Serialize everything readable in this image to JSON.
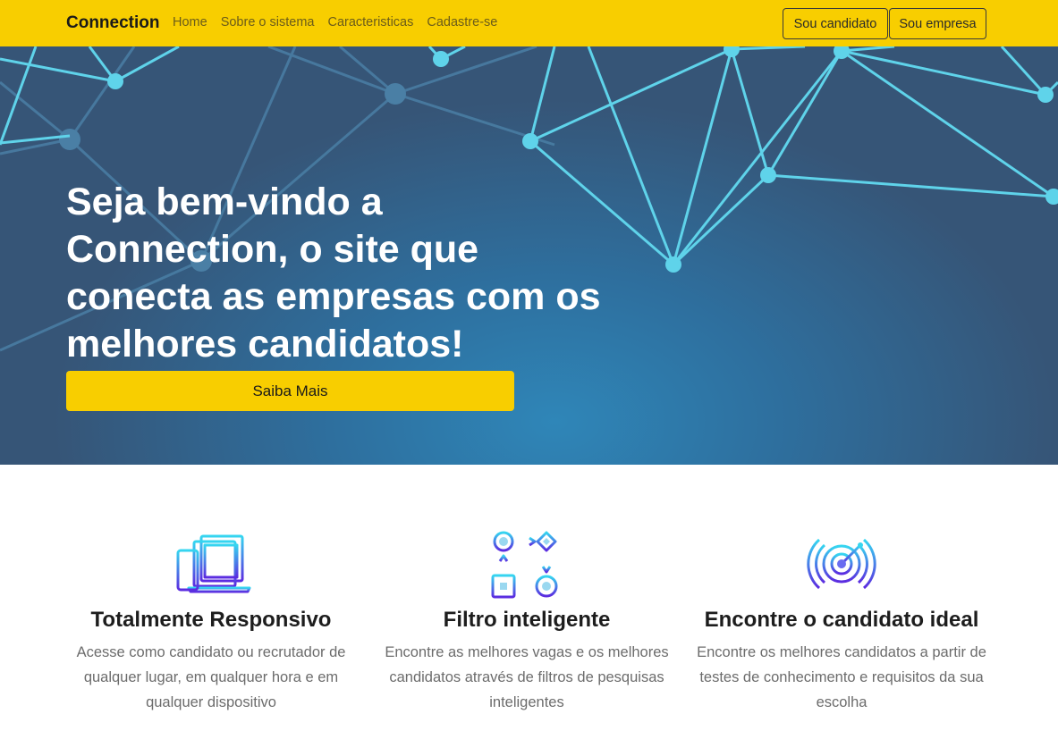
{
  "nav": {
    "brand": "Connection",
    "links": [
      "Home",
      "Sobre o sistema",
      "Caracteristicas",
      "Cadastre-se"
    ],
    "buttons": {
      "candidato": "Sou candidato",
      "empresa": "Sou empresa"
    }
  },
  "hero": {
    "title_lines": [
      "Seja bem-vindo a",
      "Connection, o site que",
      "conecta as empresas com os",
      "melhores candidatos!"
    ],
    "cta": "Saiba Mais"
  },
  "features": [
    {
      "icon": "devices-icon",
      "title": "Totalmente Responsivo",
      "text": "Acesse como candidato ou recrutador de qualquer lugar, em qualquer hora e em qualquer dispositivo"
    },
    {
      "icon": "flowchart-icon",
      "title": "Filtro inteligente",
      "text": "Encontre as melhores vagas e os melhores candidatos através de filtros de pesquisas inteligentes"
    },
    {
      "icon": "radar-target-icon",
      "title": "Encontre o candidato ideal",
      "text": "Encontre os melhores candidatos a partir de testes de conhecimento e requisitos da sua escolha"
    }
  ],
  "colors": {
    "accent_yellow": "#f8ce00",
    "hero_blue": "#2f86b8",
    "network_cyan": "#5fd3ea"
  }
}
